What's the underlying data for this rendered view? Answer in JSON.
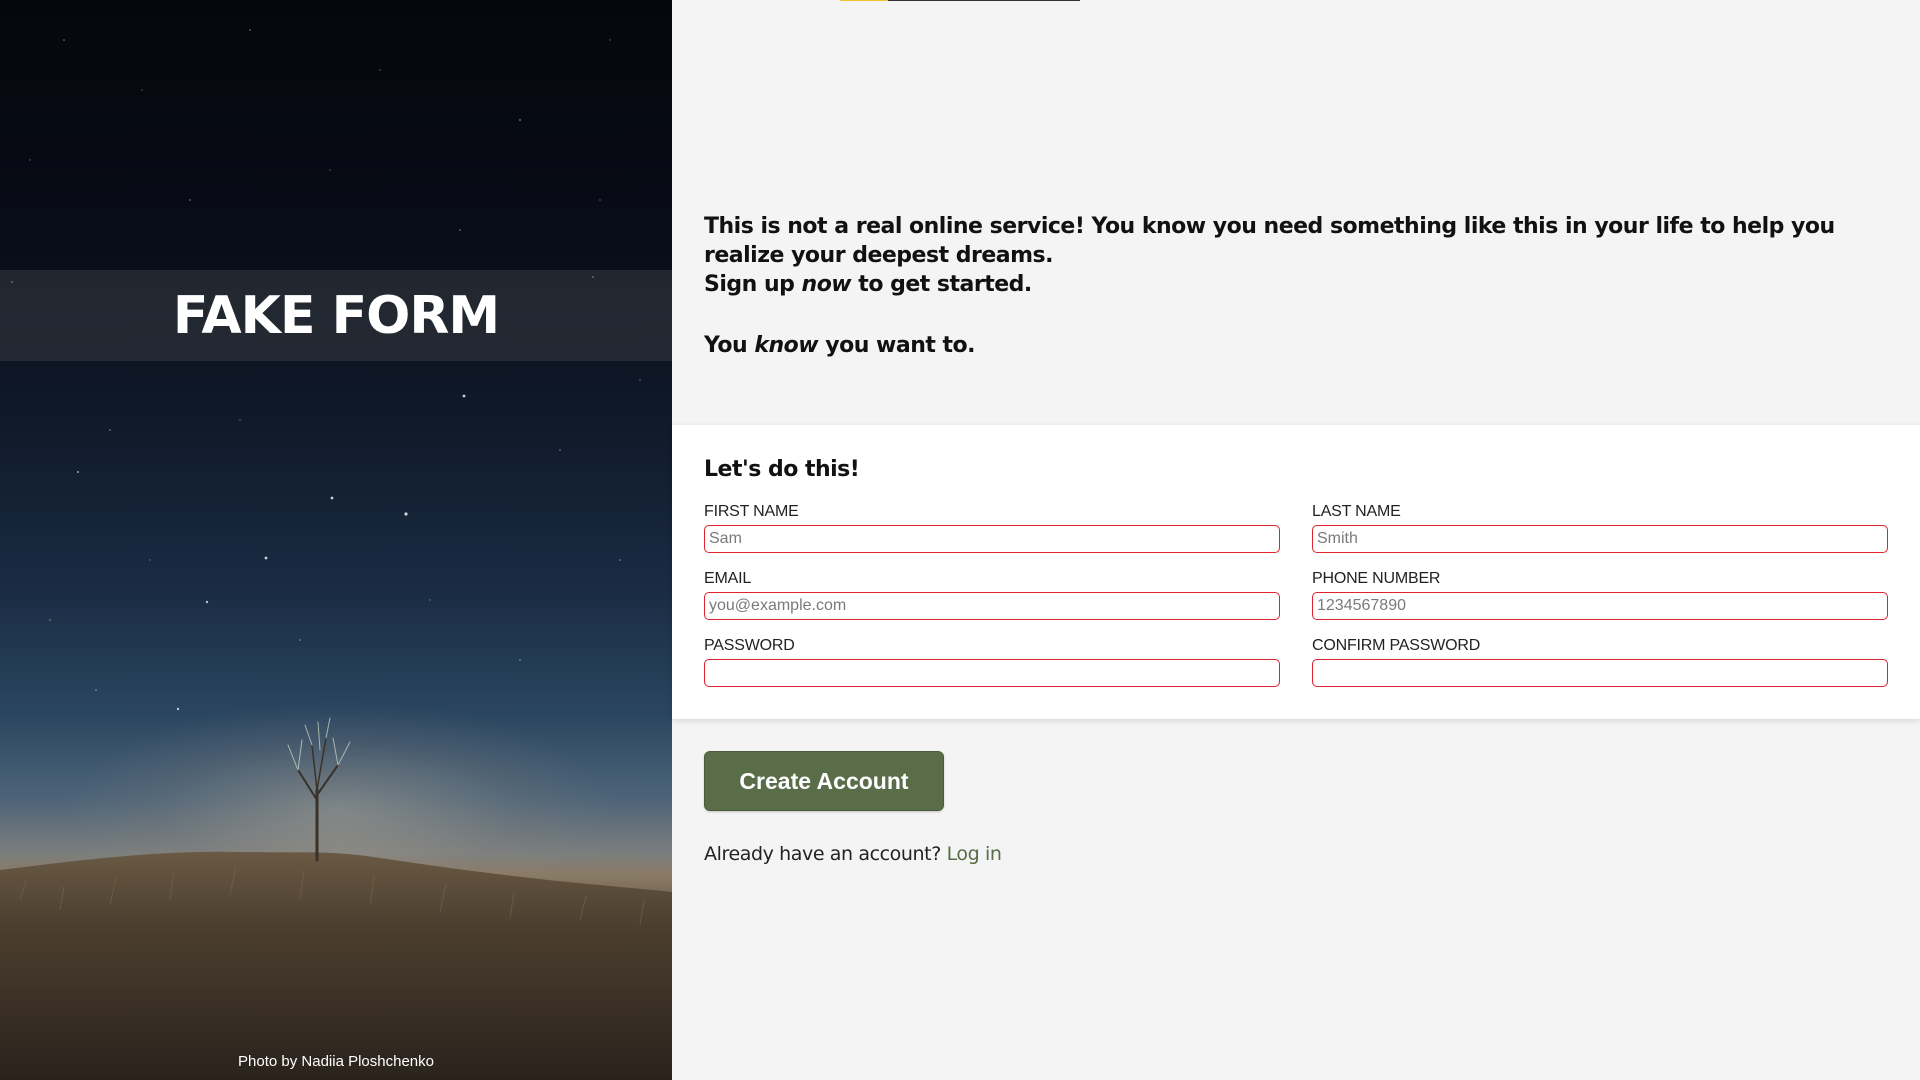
{
  "hero": {
    "title": "FAKE FORM",
    "photo_credit": "Photo by Nadiia Ploshchenko"
  },
  "intro": {
    "line1": "This is not a real online service! You know you need something like this in your life to help you realize your deepest dreams.",
    "line2_prefix": "Sign up ",
    "line2_em": "now",
    "line2_suffix": " to get started.",
    "line3_prefix": "You ",
    "line3_em": "know",
    "line3_suffix": " you want to."
  },
  "form": {
    "heading": "Let's do this!",
    "fields": {
      "first_name": {
        "label": "FIRST NAME",
        "placeholder": "Sam",
        "value": ""
      },
      "last_name": {
        "label": "LAST NAME",
        "placeholder": "Smith",
        "value": ""
      },
      "email": {
        "label": "EMAIL",
        "placeholder": "you@example.com",
        "value": ""
      },
      "phone": {
        "label": "PHONE NUMBER",
        "placeholder": "1234567890",
        "value": ""
      },
      "password": {
        "label": "PASSWORD",
        "placeholder": "",
        "value": ""
      },
      "confirm_password": {
        "label": "CONFIRM PASSWORD",
        "placeholder": "",
        "value": ""
      }
    }
  },
  "actions": {
    "create_label": "Create Account",
    "login_prompt": "Already have an account? ",
    "login_link": "Log in"
  },
  "colors": {
    "accent_green": "#596d48",
    "invalid_border": "#e0242f",
    "top_accent_yellow": "#f4c430",
    "page_background": "#f4f4f4"
  }
}
